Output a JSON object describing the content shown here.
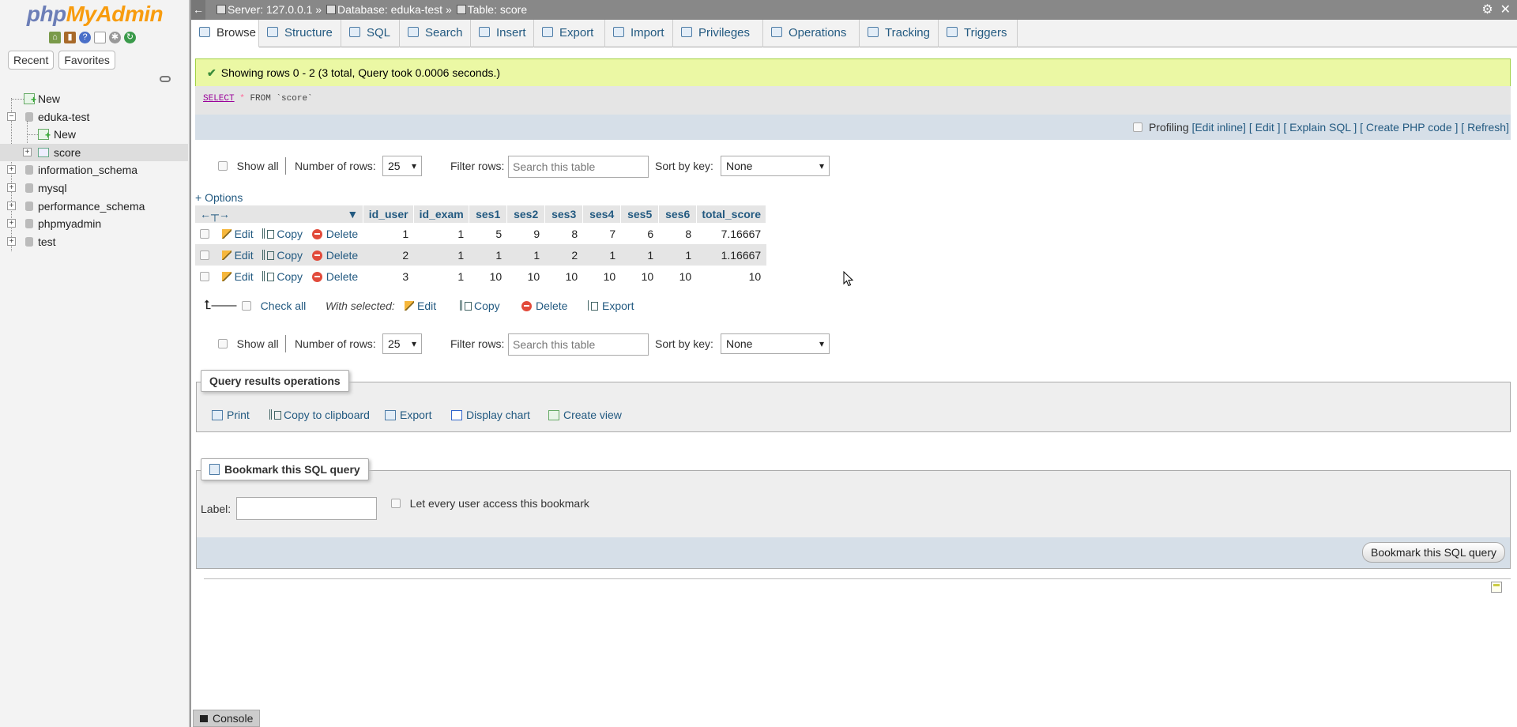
{
  "nav": {
    "logo_php": "php",
    "logo_myadmin": "MyAdmin",
    "tabs": [
      "Recent",
      "Favorites"
    ],
    "tree": {
      "new": "New",
      "db_current": "eduka-test",
      "db_current_new": "New",
      "table_current": "score",
      "other_dbs": [
        "information_schema",
        "mysql",
        "performance_schema",
        "phpmyadmin",
        "test"
      ]
    }
  },
  "topbar": {
    "server": "Server: 127.0.0.1 »",
    "database": "Database: eduka-test »",
    "table": "Table: score"
  },
  "menu": {
    "tabs": [
      "Browse",
      "Structure",
      "SQL",
      "Search",
      "Insert",
      "Export",
      "Import",
      "Privileges",
      "Operations",
      "Tracking",
      "Triggers"
    ]
  },
  "message": {
    "success": "Showing rows 0 - 2 (3 total, Query took 0.0006 seconds.)"
  },
  "sql": {
    "select": "SELECT",
    "star": "*",
    "rest": "FROM `score`"
  },
  "profiling": {
    "label": "Profiling",
    "links": [
      "[Edit inline]",
      "[ Edit ]",
      "[ Explain SQL ]",
      "[ Create PHP code ]",
      "[ Refresh]"
    ]
  },
  "navigation": {
    "show_all": "Show all",
    "number_of_rows_label": "Number of rows:",
    "number_of_rows_value": "25",
    "filter_rows_label": "Filter rows:",
    "filter_placeholder": "Search this table",
    "sort_by_label": "Sort by key:",
    "sort_by_value": "None"
  },
  "options_link": "+ Options",
  "table": {
    "headers": [
      "id_user",
      "id_exam",
      "ses1",
      "ses2",
      "ses3",
      "ses4",
      "ses5",
      "ses6",
      "total_score"
    ],
    "actions": {
      "edit": "Edit",
      "copy": "Copy",
      "delete": "Delete"
    },
    "rows": [
      [
        "1",
        "1",
        "5",
        "9",
        "8",
        "7",
        "6",
        "8",
        "7.16667"
      ],
      [
        "2",
        "1",
        "1",
        "1",
        "2",
        "1",
        "1",
        "1",
        "1.16667"
      ],
      [
        "3",
        "1",
        "10",
        "10",
        "10",
        "10",
        "10",
        "10",
        "10"
      ]
    ]
  },
  "with_selected": {
    "check_all": "Check all",
    "label": "With selected:",
    "edit": "Edit",
    "copy": "Copy",
    "delete": "Delete",
    "export": "Export"
  },
  "query_ops": {
    "legend": "Query results operations",
    "print": "Print",
    "copy_clipboard": "Copy to clipboard",
    "export": "Export",
    "display_chart": "Display chart",
    "create_view": "Create view"
  },
  "bookmark": {
    "legend": "Bookmark this SQL query",
    "label": "Label:",
    "let_every_user": "Let every user access this bookmark",
    "button": "Bookmark this SQL query"
  },
  "console": "Console"
}
